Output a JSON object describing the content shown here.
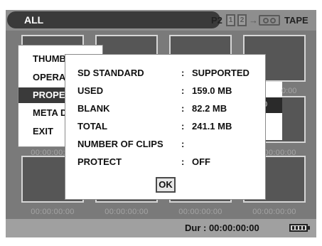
{
  "topbar": {
    "mode": "ALL",
    "card_label": "P2",
    "slot_1": "1",
    "slot_2": "2",
    "arrow": "→",
    "destination": "TAPE",
    "tape_icon": "cassette-tape-icon"
  },
  "grid": {
    "timecodes": [
      "00:00:00:00",
      "00:00:00:00",
      "00:00:00:00",
      "00:00:00:00",
      "00:00:00:00",
      "00:00:00:00",
      "00:00:00:00",
      "00:00:00:00",
      "00:00:00:00"
    ]
  },
  "menu": {
    "items": [
      {
        "label": "THUMBNAIL"
      },
      {
        "label": "OPERATION"
      },
      {
        "label": "PROPERTY",
        "selected": true
      },
      {
        "label": "META DATA"
      },
      {
        "label": "EXIT"
      }
    ]
  },
  "submenu": {
    "timecode_top": "0:00",
    "timecode_selected": "0"
  },
  "dialog": {
    "rows": [
      {
        "label": "SD STANDARD",
        "colon": ":",
        "value": "SUPPORTED"
      },
      {
        "label": "USED",
        "colon": ":",
        "value": "159.0 MB"
      },
      {
        "label": "BLANK",
        "colon": ":",
        "value": "82.2 MB"
      },
      {
        "label": "TOTAL",
        "colon": ":",
        "value": "241.1 MB"
      },
      {
        "label": "NUMBER OF CLIPS",
        "colon": ":",
        "value": ""
      },
      {
        "label": "PROTECT",
        "colon": ":",
        "value": "OFF"
      }
    ],
    "ok_label": "OK"
  },
  "status": {
    "duration": "Dur : 00:00:00:00",
    "battery_icon": "battery-icon"
  },
  "colors": {
    "grid_background": "#7a7a7a",
    "thumbnail_fill": "#565656",
    "selection": "#3a3a3a",
    "topbar": "#8e8e8e"
  }
}
